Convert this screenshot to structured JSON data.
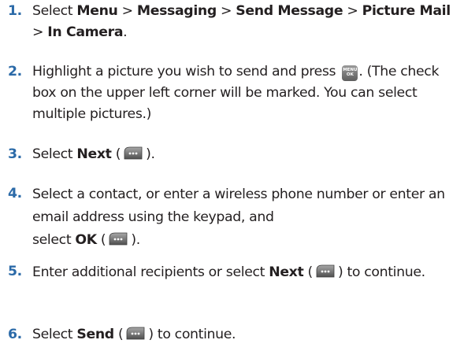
{
  "steps": [
    {
      "number": "1.",
      "segments": [
        {
          "text": "Select ",
          "bold": false
        },
        {
          "text": "Menu",
          "bold": true
        },
        {
          "text": " > ",
          "bold": false
        },
        {
          "text": "Messaging",
          "bold": true
        },
        {
          "text": " > ",
          "bold": false
        },
        {
          "text": "Send Message",
          "bold": true
        },
        {
          "text": " > ",
          "bold": false
        },
        {
          "text": "Picture Mail",
          "bold": true
        },
        {
          "text": " > ",
          "bold": false
        },
        {
          "text": "In Camera",
          "bold": true
        },
        {
          "text": ".",
          "bold": false
        }
      ]
    },
    {
      "number": "2.",
      "segments": [
        {
          "text": "Highlight a picture you wish to send and press ",
          "bold": false
        },
        {
          "key": "menu-ok"
        },
        {
          "text": ". (The check box on the upper left corner will be marked. You can select multiple pictures.)",
          "bold": false
        }
      ]
    },
    {
      "number": "3.",
      "segments": [
        {
          "text": "Select ",
          "bold": false
        },
        {
          "text": "Next",
          "bold": true
        },
        {
          "text": " (",
          "bold": false
        },
        {
          "key": "softkey"
        },
        {
          "text": ").",
          "bold": false
        }
      ]
    },
    {
      "number": "4.",
      "segments": [
        {
          "text": "Select a contact, or enter a wireless phone number or enter an email address using the keypad, and",
          "bold": false
        },
        {
          "break": true
        },
        {
          "text": "select ",
          "bold": false
        },
        {
          "text": "OK",
          "bold": true
        },
        {
          "text": " (",
          "bold": false
        },
        {
          "key": "softkey"
        },
        {
          "text": ").",
          "bold": false
        }
      ]
    },
    {
      "number": "5.",
      "segments": [
        {
          "text": "Enter additional recipients or select ",
          "bold": false
        },
        {
          "text": "Next",
          "bold": true
        },
        {
          "text": " (",
          "bold": false
        },
        {
          "key": "softkey"
        },
        {
          "text": ") to continue.",
          "bold": false
        }
      ]
    },
    {
      "number": "6.",
      "segments": [
        {
          "text": "Select ",
          "bold": false
        },
        {
          "text": "Send",
          "bold": true
        },
        {
          "text": " (",
          "bold": false
        },
        {
          "key": "softkey"
        },
        {
          "text": ") to continue.",
          "bold": false
        }
      ]
    }
  ],
  "keys": {
    "menu-ok": {
      "icon": "menu-ok-key-icon",
      "line1": "MENU",
      "line2": "OK"
    },
    "softkey": {
      "icon": "softkey-icon"
    }
  },
  "colors": {
    "step_number": "#2b6aa8",
    "text": "#231f20",
    "key_fill": "#6e6e6e"
  }
}
